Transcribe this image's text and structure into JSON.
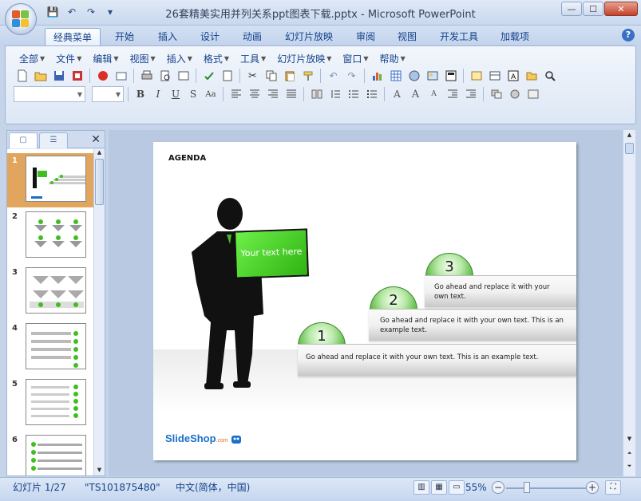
{
  "window": {
    "title": "26套精美实用并列关系ppt图表下载.pptx - Microsoft PowerPoint",
    "minimize": "—",
    "maximize": "☐",
    "close": "✕"
  },
  "qat": [
    "💾",
    "↶",
    "↷",
    "▾"
  ],
  "tabs": [
    "经典菜单",
    "开始",
    "插入",
    "设计",
    "动画",
    "幻灯片放映",
    "审阅",
    "视图",
    "开发工具",
    "加载项"
  ],
  "help": "?",
  "menu": [
    "全部",
    "文件",
    "编辑",
    "视图",
    "插入",
    "格式",
    "工具",
    "幻灯片放映",
    "窗口",
    "帮助"
  ],
  "format_buttons": [
    "B",
    "I",
    "U",
    "S",
    "Aa"
  ],
  "panel": {
    "close": "✕",
    "thumbs": [
      {
        "num": "1"
      },
      {
        "num": "2"
      },
      {
        "num": "3"
      },
      {
        "num": "4"
      },
      {
        "num": "5"
      },
      {
        "num": "6"
      }
    ]
  },
  "slide": {
    "agenda": "AGENDA",
    "board_text": "Your text here",
    "steps": [
      {
        "num": "1",
        "text": "Go ahead and replace it with your own text. This is an example text."
      },
      {
        "num": "2",
        "text": "Go ahead and replace it with your own text. This is an example text."
      },
      {
        "num": "3",
        "text": "Go ahead and replace it with your own text."
      }
    ],
    "logo_main": "SlideShop",
    "logo_sub": ".com"
  },
  "status": {
    "slide_info": "幻灯片 1/27",
    "theme": "\"TS101875480\"",
    "language": "中文(简体，中国)",
    "zoom": "55%",
    "zoom_minus": "−",
    "zoom_plus": "+"
  },
  "colors": {
    "accent_green": "#3fbf1f",
    "ribbon_blue": "#15428b",
    "selected_thumb": "#e2a55d"
  }
}
